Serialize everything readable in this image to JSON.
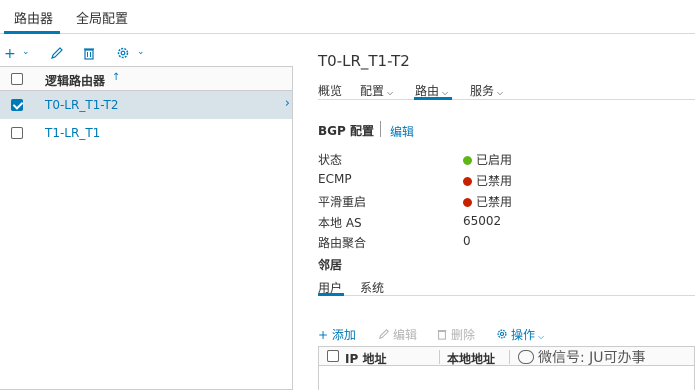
{
  "top_tabs": [
    {
      "label": "路由器",
      "active": true
    },
    {
      "label": "全局配置",
      "active": false
    }
  ],
  "left_toolbar": {
    "add_icon": "plus-icon",
    "edit_icon": "pencil-icon",
    "delete_icon": "trash-icon",
    "settings_icon": "gear-icon"
  },
  "router_list": {
    "column_title": "逻辑路由器",
    "sort_icon": "sort-ascending-icon",
    "rows": [
      {
        "label": "T0-LR_T1-T2",
        "selected": true
      },
      {
        "label": "T1-LR_T1",
        "selected": false
      }
    ]
  },
  "detail": {
    "title": "T0-LR_T1-T2",
    "tabs": [
      {
        "label": "概览",
        "has_caret": false,
        "active": false
      },
      {
        "label": "配置",
        "has_caret": true,
        "active": false
      },
      {
        "label": "路由",
        "has_caret": true,
        "active": true
      },
      {
        "label": "服务",
        "has_caret": true,
        "active": false
      }
    ],
    "bgp_section": {
      "title": "BGP 配置",
      "edit_label": "编辑"
    },
    "fields": [
      {
        "label": "状态",
        "value": "已启用",
        "status_color": "#5eb715"
      },
      {
        "label": "ECMP",
        "value": "已禁用",
        "status_color": "#c92100"
      },
      {
        "label": "平滑重启",
        "value": "已禁用",
        "status_color": "#c92100"
      },
      {
        "label": "本地 AS",
        "value": "65002"
      },
      {
        "label": "路由聚合",
        "value": "0"
      }
    ],
    "neighbors": {
      "title": "邻居",
      "tabs": [
        {
          "label": "用户",
          "active": true
        },
        {
          "label": "系统",
          "active": false
        }
      ],
      "toolbar": {
        "add_label": "+ 添加",
        "edit_label": "编辑",
        "delete_label": "删除",
        "actions_label": "操作"
      },
      "columns": [
        "IP 地址",
        "本地地址"
      ]
    }
  },
  "watermark": {
    "text": "微信号: JU可办事"
  },
  "colors": {
    "accent": "#0079b8",
    "selected_row": "#d8e3e9",
    "enabled": "#5eb715",
    "disabled": "#c92100"
  }
}
